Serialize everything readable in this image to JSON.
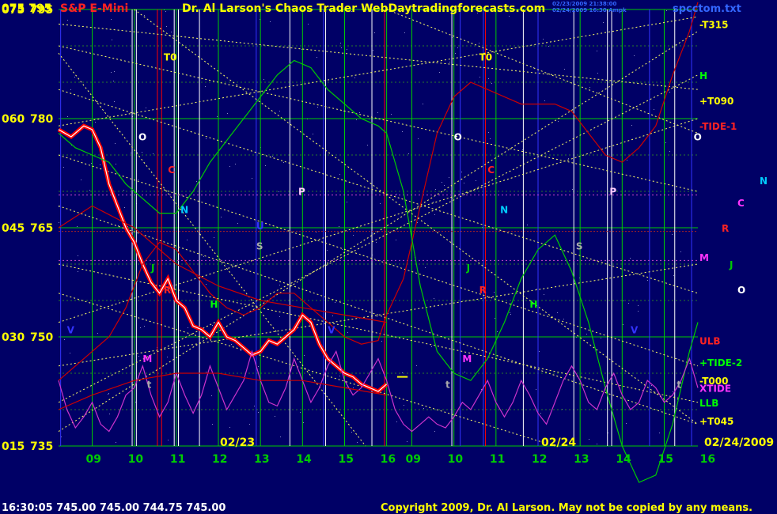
{
  "header": {
    "corner_values": "075  795",
    "instrument": "S&P E-Mini",
    "title": "Dr. Al Larson's Chaos Trader WebDaytradingforecasts.com",
    "stamp_line1": "02/23/2009 21:38:00",
    "stamp_line2": "02/24/2009 16:30 Ampk",
    "filename": "spcctom.txt"
  },
  "footer": {
    "last_quote": "16:30:05  745.00  745.00  744.75  745.00",
    "copyright": "Copyright 2009, Dr. Al Larson. May not be copied by any means.",
    "date_left": "02/23",
    "date_mid": "02/24",
    "date_right": "02/24/2009"
  },
  "colors": {
    "background": "#000066",
    "grid_green": "#00cc00",
    "price_white": "#ffffff",
    "price_red": "#ff0000",
    "tide_red": "#cc0000",
    "tide2_green": "#00cc00",
    "xtide_magenta": "#cc33cc",
    "flux_yellow": "#ffff66"
  },
  "chart_data": {
    "type": "line",
    "title": "S&P E-Mini",
    "y_axis_left": [
      "075",
      "060",
      "045",
      "030",
      "015"
    ],
    "y_axis_price": [
      "795",
      "780",
      "765",
      "750",
      "735"
    ],
    "ylim": [
      735,
      795
    ],
    "x_ticks_day1": [
      "09",
      "10",
      "11",
      "12",
      "13",
      "14",
      "15",
      "16"
    ],
    "x_ticks_day2": [
      "09",
      "10",
      "11",
      "12",
      "13",
      "14",
      "15",
      "16"
    ],
    "right_labels": [
      {
        "text": "-T315",
        "color": "#ffff00"
      },
      {
        "text": "H",
        "color": "#00ff00"
      },
      {
        "text": "+T090",
        "color": "#ffff00"
      },
      {
        "text": "-TIDE-1",
        "color": "#ff2222"
      },
      {
        "text": "M",
        "color": "#ff33ff"
      },
      {
        "text": "ULB",
        "color": "#ff2222"
      },
      {
        "text": "+TIDE-2",
        "color": "#00ff00"
      },
      {
        "text": "-T000",
        "color": "#ffff00"
      },
      {
        "text": "XTIDE",
        "color": "#ff33ff"
      },
      {
        "text": "LLB",
        "color": "#00ff00"
      },
      {
        "text": "+T045",
        "color": "#ffff00"
      }
    ],
    "outer_labels": [
      {
        "text": "N",
        "color": "#00ccff"
      },
      {
        "text": "C",
        "color": "#ff33ff"
      },
      {
        "text": "R",
        "color": "#ff2222"
      },
      {
        "text": "J",
        "color": "#00cc00"
      },
      {
        "text": "O",
        "color": "#ffffff"
      }
    ],
    "planet_labels_day1": [
      {
        "text": "T0",
        "color": "#ffff00"
      },
      {
        "text": "O",
        "color": "#ffffff"
      },
      {
        "text": "C",
        "color": "#ff2222"
      },
      {
        "text": "P",
        "color": "#ffccff"
      },
      {
        "text": "N",
        "color": "#00ccff"
      },
      {
        "text": "U",
        "color": "#3333ff"
      },
      {
        "text": "S",
        "color": "#aaaaaa"
      },
      {
        "text": "J",
        "color": "#00cc00"
      },
      {
        "text": "R",
        "color": "#ff2222"
      },
      {
        "text": "H",
        "color": "#00ff00"
      },
      {
        "text": "V",
        "color": "#3333ff"
      },
      {
        "text": "M",
        "color": "#ff33ff"
      },
      {
        "text": "t",
        "color": "#aaaaaa"
      },
      {
        "text": "V",
        "color": "#3333ff"
      }
    ],
    "planet_labels_day2": [
      {
        "text": "T0",
        "color": "#ffff00"
      },
      {
        "text": "O",
        "color": "#ffffff"
      },
      {
        "text": "C",
        "color": "#ff2222"
      },
      {
        "text": "P",
        "color": "#ffccff"
      },
      {
        "text": "N",
        "color": "#00ccff"
      },
      {
        "text": "S",
        "color": "#aaaaaa"
      },
      {
        "text": "J",
        "color": "#00cc00"
      },
      {
        "text": "R",
        "color": "#ff2222"
      },
      {
        "text": "H",
        "color": "#00ff00"
      },
      {
        "text": "M",
        "color": "#ff33ff"
      },
      {
        "text": "t",
        "color": "#aaaaaa"
      },
      {
        "text": "V",
        "color": "#3333ff"
      },
      {
        "text": "t",
        "color": "#aaaaaa"
      },
      {
        "text": "O",
        "color": "#ffffff"
      }
    ],
    "series": [
      {
        "key": "price",
        "x": [
          8.2,
          8.5,
          8.8,
          9.0,
          9.2,
          9.4,
          9.6,
          9.8,
          10.0,
          10.2,
          10.4,
          10.6,
          10.8,
          11.0,
          11.2,
          11.4,
          11.6,
          11.8,
          12.0,
          12.2,
          12.4,
          12.6,
          12.8,
          13.0,
          13.2,
          13.4,
          13.6,
          13.8,
          14.0,
          14.2,
          14.4,
          14.6,
          14.8,
          15.0,
          15.2,
          15.4,
          15.6,
          15.8,
          16.0
        ],
        "values": [
          778.5,
          777.5,
          779,
          778.5,
          776,
          771,
          768,
          765,
          763,
          760,
          757.5,
          756,
          758,
          755,
          754,
          751.5,
          751,
          750,
          752,
          750,
          749.5,
          748.5,
          747.5,
          748,
          749.5,
          749,
          750,
          751,
          753,
          752,
          749,
          747,
          746,
          745,
          744.5,
          743.5,
          743,
          742.5,
          743.5
        ]
      },
      {
        "key": "tide1",
        "x": [
          8.2,
          8.6,
          9.0,
          9.4,
          9.8,
          10.2,
          10.6,
          11.0,
          11.4,
          11.8,
          12.2,
          12.6,
          13.0,
          13.4,
          13.8,
          14.2,
          14.6,
          15.0,
          15.4,
          15.8,
          16.0,
          16.4,
          16.8,
          17.2,
          17.6,
          18.0,
          18.4,
          18.8,
          19.2,
          19.6,
          20.0,
          20.4,
          20.8,
          21.2,
          21.6,
          22.0,
          22.4,
          22.8,
          23.2,
          23.4
        ],
        "values": [
          744,
          746,
          748,
          750,
          754,
          760,
          763,
          762,
          759,
          756,
          754,
          753,
          754,
          756,
          756,
          754,
          752,
          750,
          749,
          749.5,
          753,
          758,
          768,
          778,
          783,
          785,
          784,
          783,
          782,
          782,
          782,
          781,
          778,
          775,
          774,
          776,
          779,
          786,
          792,
          796
        ]
      },
      {
        "key": "tide2",
        "x": [
          8.2,
          8.6,
          9.0,
          9.4,
          9.8,
          10.2,
          10.6,
          11.0,
          11.4,
          11.8,
          12.2,
          12.6,
          13.0,
          13.4,
          13.8,
          14.2,
          14.6,
          15.0,
          15.4,
          15.8,
          16.0,
          16.4,
          16.8,
          17.2,
          17.6,
          18.0,
          18.4,
          18.8,
          19.2,
          19.6,
          20.0,
          20.4,
          20.8,
          21.2,
          21.6,
          22.0,
          22.4,
          22.8,
          23.2,
          23.4
        ],
        "values": [
          778,
          776,
          775,
          774,
          771,
          769,
          767,
          767,
          770,
          774,
          777,
          780,
          783,
          786,
          788,
          787,
          784,
          782,
          780,
          779,
          778,
          770,
          757,
          748,
          745,
          744,
          747,
          752,
          758,
          762,
          764,
          759,
          752,
          743,
          735,
          730,
          731,
          738,
          748,
          752
        ]
      },
      {
        "key": "xtide",
        "x": [
          8.2,
          8.4,
          8.6,
          8.8,
          9.0,
          9.2,
          9.4,
          9.6,
          9.8,
          10.0,
          10.2,
          10.4,
          10.6,
          10.8,
          11.0,
          11.2,
          11.4,
          11.6,
          11.8,
          12.0,
          12.2,
          12.4,
          12.6,
          12.8,
          13.0,
          13.2,
          13.4,
          13.6,
          13.8,
          14.0,
          14.2,
          14.4,
          14.6,
          14.8,
          15.0,
          15.2,
          15.4,
          15.6,
          15.8,
          16.0,
          16.2,
          16.4,
          16.6,
          16.8,
          17.0,
          17.2,
          17.4,
          17.6,
          17.8,
          18.0,
          18.2,
          18.4,
          18.6,
          18.8,
          19.0,
          19.2,
          19.4,
          19.6,
          19.8,
          20.0,
          20.2,
          20.4,
          20.6,
          20.8,
          21.0,
          21.2,
          21.4,
          21.6,
          21.8,
          22.0,
          22.2,
          22.4,
          22.6,
          22.8,
          23.0,
          23.2,
          23.4
        ],
        "values": [
          744,
          740,
          737.5,
          739,
          741,
          738,
          737,
          739,
          742,
          743,
          746,
          742,
          739,
          741,
          745,
          742,
          739.5,
          742,
          746,
          743,
          740,
          742,
          744,
          748,
          744,
          741,
          740.5,
          743,
          747,
          744,
          741,
          743,
          746,
          748,
          744,
          742,
          743,
          745,
          747,
          744,
          740,
          738,
          737,
          738,
          739,
          738,
          737.5,
          739,
          741,
          740,
          742,
          744,
          741,
          739,
          741,
          744,
          742,
          739.5,
          738,
          741,
          744,
          746,
          744,
          741,
          740,
          743,
          745,
          742,
          740,
          741,
          744,
          743,
          741,
          742,
          744,
          747,
          743
        ]
      },
      {
        "key": "upper_band",
        "x": [
          8.2,
          9.0,
          10.0,
          11.0,
          12.0,
          13.0,
          14.0,
          15.0,
          16.0
        ],
        "values": [
          765,
          768,
          765,
          760,
          757,
          755,
          754,
          753,
          752
        ]
      },
      {
        "key": "lower_band",
        "x": [
          8.2,
          9.0,
          10.0,
          11.0,
          12.0,
          13.0,
          14.0,
          15.0,
          16.0
        ],
        "values": [
          740,
          742,
          744,
          745,
          745,
          744,
          744,
          743,
          742
        ]
      }
    ]
  }
}
